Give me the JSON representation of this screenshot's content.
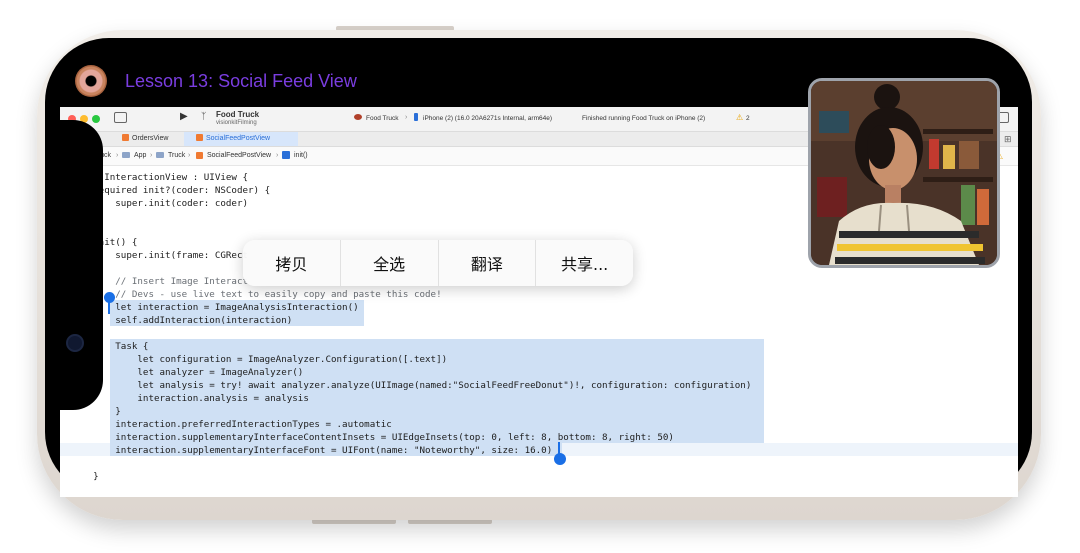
{
  "lesson": {
    "title": "Lesson 13: Social Feed View"
  },
  "toolbar": {
    "project_name": "Food Truck",
    "project_sub": "visionkitFilming",
    "scheme": "Food Truck",
    "device": "iPhone (2) (16.0 20A6271s Internal, arm64e)",
    "status": "Finished running Food Truck on iPhone (2)",
    "warning_count": "2"
  },
  "tabs": [
    "OrdersView",
    "SocialFeedPostView"
  ],
  "jumpbar": [
    "Food Truck",
    "App",
    "Truck",
    "SocialFeedPostView",
    "init()"
  ],
  "context_menu": [
    "拷贝",
    "全选",
    "翻译",
    "共享..."
  ],
  "code": {
    "l1": "class InteractionView : UIView {",
    "l2": "    required init?(coder: NSCoder) {",
    "l3": "        super.init(coder: coder)",
    "l6": "    init() {",
    "l7": "        super.init(frame: CGRect",
    "l9": "        // Insert Image Interact",
    "l10": "        // Devs - use live text to easily copy and paste this code!",
    "l11": "        let interaction = ImageAnalysisInteraction()",
    "l12": "        self.addInteraction(interaction)",
    "l14": "        Task {",
    "l15": "            let configuration = ImageAnalyzer.Configuration([.text])",
    "l16": "            let analyzer = ImageAnalyzer()",
    "l17": "            let analysis = try! await analyzer.analyze(UIImage(named:\"SocialFeedFreeDonut\")!, configuration: configuration)",
    "l18": "            interaction.analysis = analysis",
    "l19": "        }",
    "l20": "        interaction.preferredInteractionTypes = .automatic",
    "l21": "        interaction.supplementaryInterfaceContentInsets = UIEdgeInsets(top: 0, left: 8, bottom: 8, right: 50)",
    "l22": "        interaction.supplementaryInterfaceFont = UIFont(name: \"Noteworthy\", size: 16.0)",
    "l24": "    }"
  },
  "colors": {
    "accent": "#7a3de0",
    "selection": "#cfe0f4",
    "handle": "#1a6fe6"
  }
}
